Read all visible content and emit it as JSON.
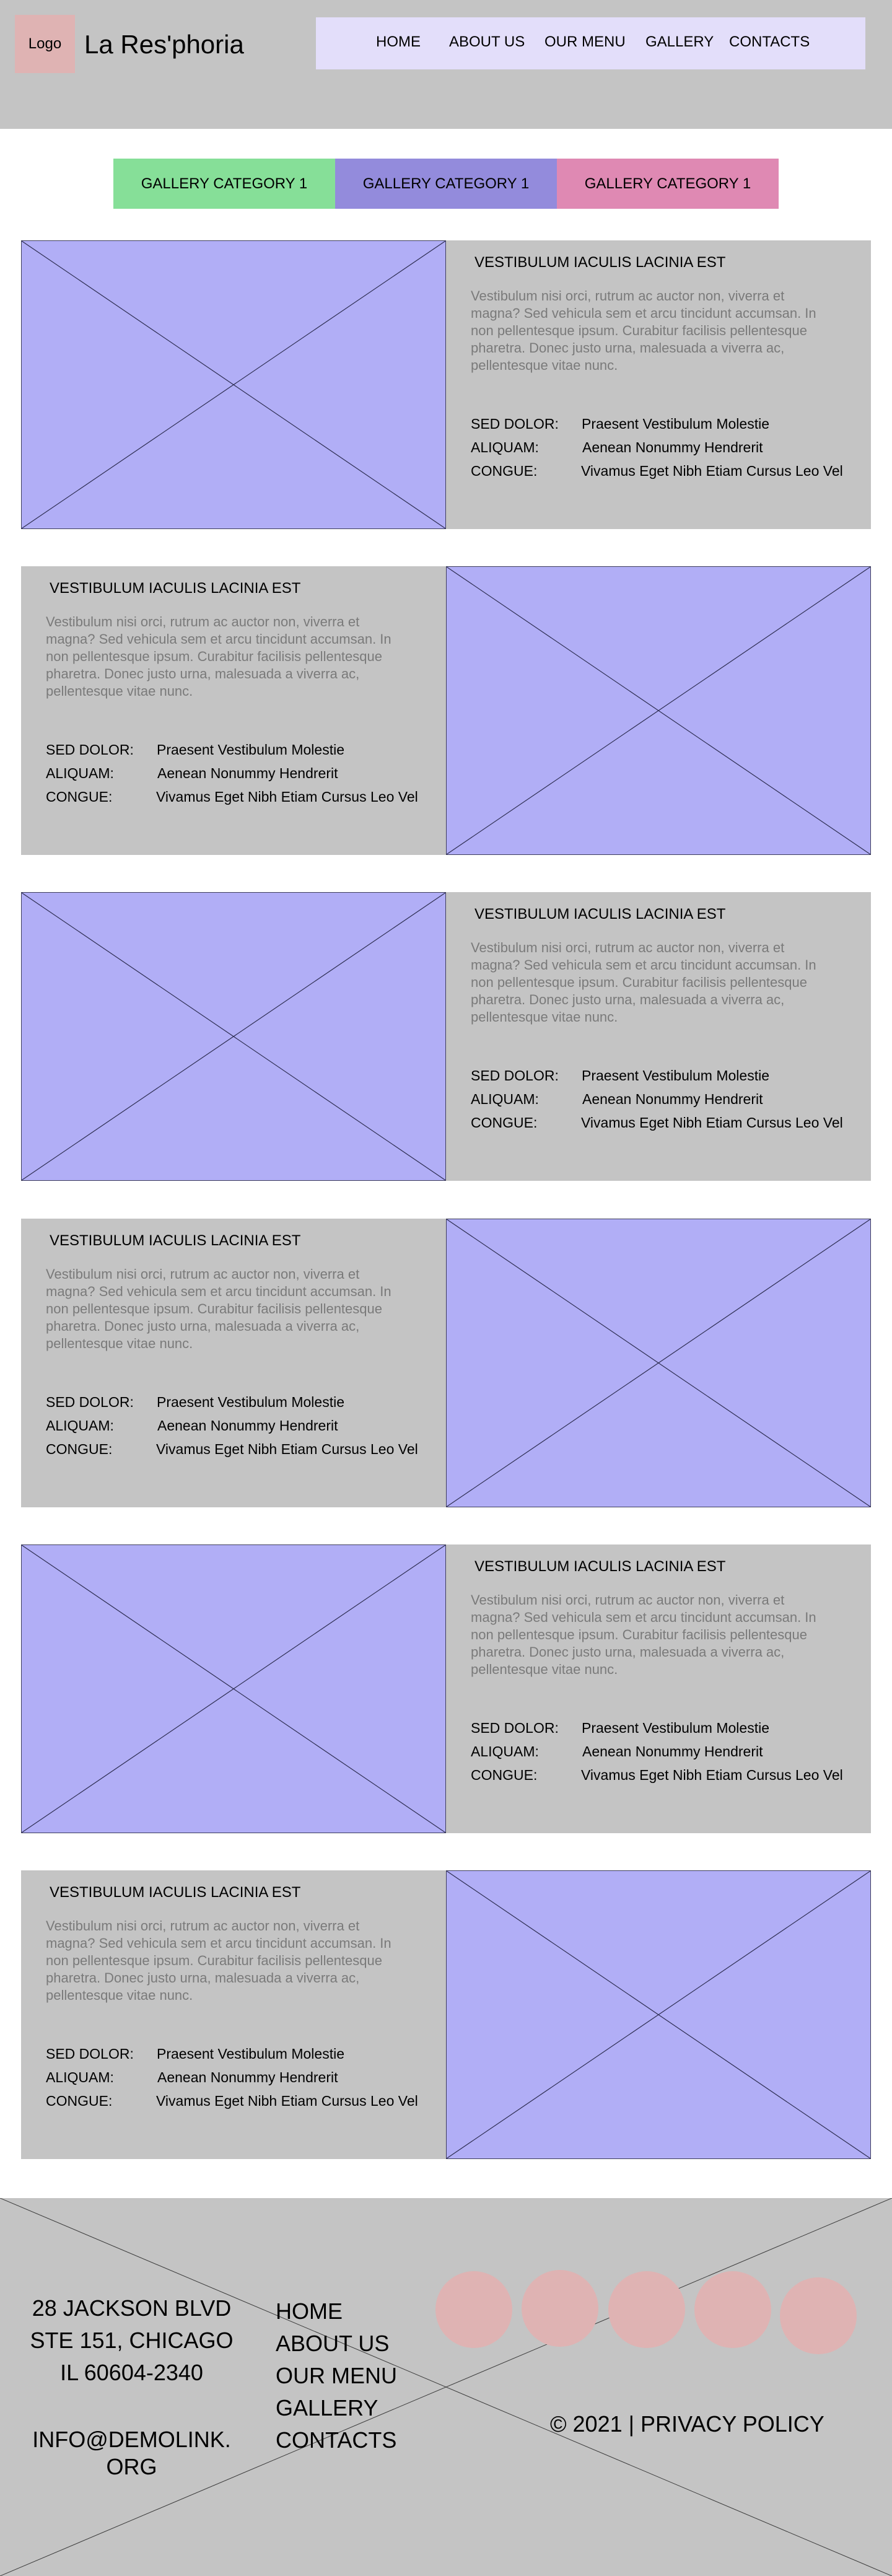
{
  "header": {
    "logo_label": "Logo",
    "site_name": "La Res'phoria",
    "nav": [
      "HOME",
      "ABOUT US",
      "OUR MENU",
      "GALLERY",
      "CONTACTS"
    ]
  },
  "tabs": [
    {
      "label": "GALLERY CATEGORY 1",
      "color": "#86df98"
    },
    {
      "label": "GALLERY CATEGORY 1",
      "color": "#938bdc"
    },
    {
      "label": "GALLERY CATEGORY 1",
      "color": "#df89b3"
    }
  ],
  "colors": {
    "image_placeholder": "#b1aef6",
    "panel_bg": "#c4c4c4",
    "social_circle": "#dfb3b3",
    "nav_bg": "#e3defa"
  },
  "items": [
    {
      "title": "VESTIBULUM IACULIS LACINIA EST",
      "description": "Vestibulum nisi orci, rutrum ac auctor non, viverra et magna? Sed vehicula sem et arcu tincidunt accumsan. In non pellentesque ipsum. Curabitur facilisis pellentesque pharetra. Donec justo urna, malesuada a viverra ac, pellentesque vitae nunc.",
      "meta": [
        {
          "label": "SED DOLOR:",
          "value": "Praesent Vestibulum Molestie"
        },
        {
          "label": "ALIQUAM:",
          "value": "Aenean Nonummy Hendrerit"
        },
        {
          "label": "CONGUE:",
          "value": "Vivamus Eget Nibh Etiam Cursus Leo Vel"
        }
      ]
    },
    {
      "title": "VESTIBULUM IACULIS LACINIA EST",
      "description": "Vestibulum nisi orci, rutrum ac auctor non, viverra et magna? Sed vehicula sem et arcu tincidunt accumsan. In non pellentesque ipsum. Curabitur facilisis pellentesque pharetra. Donec justo urna, malesuada a viverra ac, pellentesque vitae nunc.",
      "meta": [
        {
          "label": "SED DOLOR:",
          "value": "Praesent Vestibulum Molestie"
        },
        {
          "label": "ALIQUAM:",
          "value": "Aenean Nonummy Hendrerit"
        },
        {
          "label": "CONGUE:",
          "value": "Vivamus Eget Nibh Etiam Cursus Leo Vel"
        }
      ]
    },
    {
      "title": "VESTIBULUM IACULIS LACINIA EST",
      "description": "Vestibulum nisi orci, rutrum ac auctor non, viverra et magna? Sed vehicula sem et arcu tincidunt accumsan. In non pellentesque ipsum. Curabitur facilisis pellentesque pharetra. Donec justo urna, malesuada a viverra ac, pellentesque vitae nunc.",
      "meta": [
        {
          "label": "SED DOLOR:",
          "value": "Praesent Vestibulum Molestie"
        },
        {
          "label": "ALIQUAM:",
          "value": "Aenean Nonummy Hendrerit"
        },
        {
          "label": "CONGUE:",
          "value": "Vivamus Eget Nibh Etiam Cursus Leo Vel"
        }
      ]
    },
    {
      "title": "VESTIBULUM IACULIS LACINIA EST",
      "description": "Vestibulum nisi orci, rutrum ac auctor non, viverra et magna? Sed vehicula sem et arcu tincidunt accumsan. In non pellentesque ipsum. Curabitur facilisis pellentesque pharetra. Donec justo urna, malesuada a viverra ac, pellentesque vitae nunc.",
      "meta": [
        {
          "label": "SED DOLOR:",
          "value": "Praesent Vestibulum Molestie"
        },
        {
          "label": "ALIQUAM:",
          "value": "Aenean Nonummy Hendrerit"
        },
        {
          "label": "CONGUE:",
          "value": "Vivamus Eget Nibh Etiam Cursus Leo Vel"
        }
      ]
    },
    {
      "title": "VESTIBULUM IACULIS LACINIA EST",
      "description": "Vestibulum nisi orci, rutrum ac auctor non, viverra et magna? Sed vehicula sem et arcu tincidunt accumsan. In non pellentesque ipsum. Curabitur facilisis pellentesque pharetra. Donec justo urna, malesuada a viverra ac, pellentesque vitae nunc.",
      "meta": [
        {
          "label": "SED DOLOR:",
          "value": "Praesent Vestibulum Molestie"
        },
        {
          "label": "ALIQUAM:",
          "value": "Aenean Nonummy Hendrerit"
        },
        {
          "label": "CONGUE:",
          "value": "Vivamus Eget Nibh Etiam Cursus Leo Vel"
        }
      ]
    },
    {
      "title": "VESTIBULUM IACULIS LACINIA EST",
      "description": "Vestibulum nisi orci, rutrum ac auctor non, viverra et magna? Sed vehicula sem et arcu tincidunt accumsan. In non pellentesque ipsum. Curabitur facilisis pellentesque pharetra. Donec justo urna, malesuada a viverra ac, pellentesque vitae nunc.",
      "meta": [
        {
          "label": "SED DOLOR:",
          "value": "Praesent Vestibulum Molestie"
        },
        {
          "label": "ALIQUAM:",
          "value": "Aenean Nonummy Hendrerit"
        },
        {
          "label": "CONGUE:",
          "value": "Vivamus Eget Nibh Etiam Cursus Leo Vel"
        }
      ]
    }
  ],
  "footer": {
    "address_line1": "28 JACKSON BLVD",
    "address_line2": "STE 151, CHICAGO",
    "address_line3": "IL 60604-2340",
    "email_line1": "INFO@DEMOLINK.",
    "email_line2": "ORG",
    "nav": [
      "HOME",
      "ABOUT US",
      "OUR MENU",
      "GALLERY",
      "CONTACTS"
    ],
    "social_icons": [
      "social-icon-1",
      "social-icon-2",
      "social-icon-3",
      "social-icon-4",
      "social-icon-5"
    ],
    "copyright": "© 2021 | PRIVACY POLICY"
  }
}
